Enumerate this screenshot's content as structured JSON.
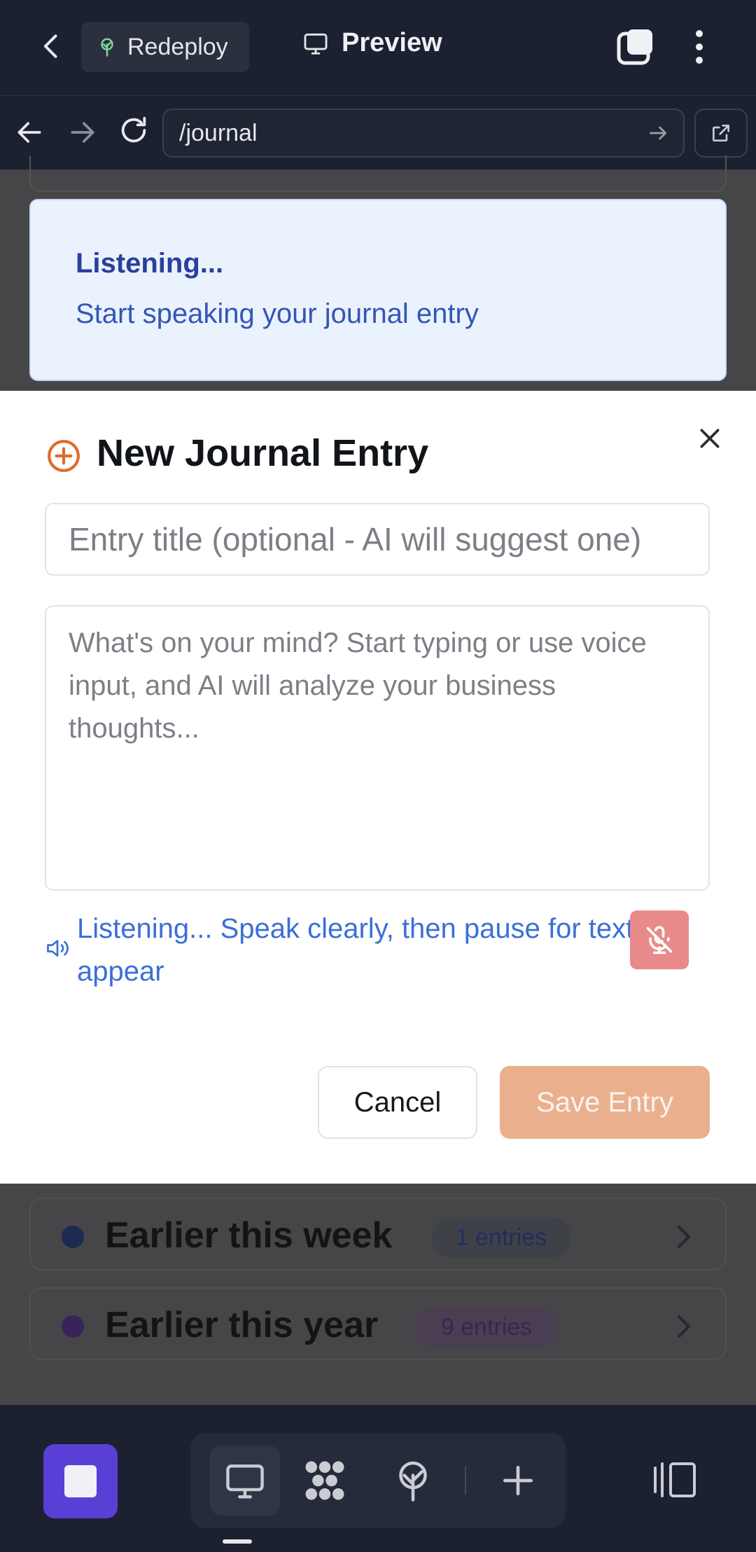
{
  "topbar": {
    "redeploy_label": "Redeploy",
    "preview_label": "Preview"
  },
  "browser": {
    "url": "/journal"
  },
  "toast": {
    "title": "Listening...",
    "message": "Start speaking your journal entry"
  },
  "modal": {
    "title": "New Journal Entry",
    "title_placeholder": "Entry title (optional - AI will suggest one)",
    "body_placeholder": "What's on your mind? Start typing or use voice input, and AI will analyze your business thoughts...",
    "listening_status": "Listening... Speak clearly, then pause for text to appear",
    "cancel_label": "Cancel",
    "save_label": "Save Entry"
  },
  "groups": [
    {
      "name": "Earlier this week",
      "badge": "1 entries",
      "dot_color": "#1c2a52"
    },
    {
      "name": "Earlier this year",
      "badge": "9 entries",
      "dot_color": "#3a2358"
    }
  ],
  "colors": {
    "accent_orange": "#e06a2c",
    "primary_purple": "#5a3fd6",
    "listening_blue": "#3a6fd8"
  }
}
